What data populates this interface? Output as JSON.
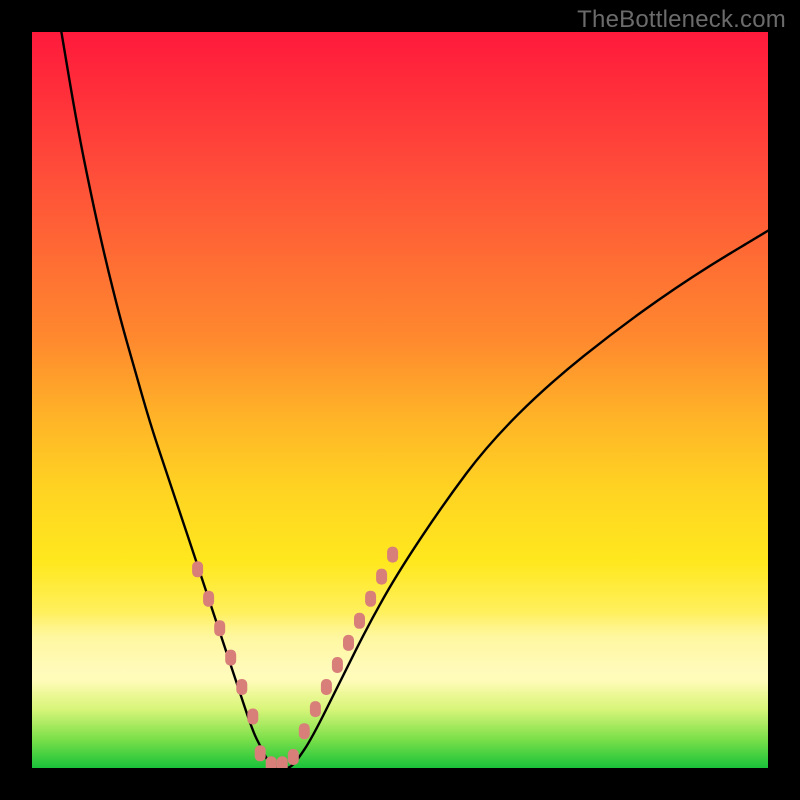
{
  "watermark": "TheBottleneck.com",
  "chart_data": {
    "type": "line",
    "title": "",
    "xlabel": "",
    "ylabel": "",
    "xlim": [
      0,
      100
    ],
    "ylim": [
      0,
      100
    ],
    "grid": false,
    "series": [
      {
        "name": "bottleneck-curve",
        "color": "#000000",
        "x": [
          4,
          6,
          8,
          10,
          12,
          14,
          16,
          18,
          20,
          22,
          24,
          26,
          28,
          30,
          31,
          32,
          33,
          34,
          35,
          36,
          38,
          42,
          46,
          50,
          56,
          62,
          70,
          80,
          90,
          100
        ],
        "values": [
          100,
          88,
          78,
          69,
          61,
          54,
          47,
          41,
          35,
          29,
          23,
          17,
          11,
          5,
          3,
          1,
          0,
          0,
          0,
          1,
          4,
          12,
          20,
          27,
          36,
          44,
          52,
          60,
          67,
          73
        ]
      },
      {
        "name": "marker-dots-left",
        "color": "#d87f7a",
        "x": [
          22.5,
          24.0,
          25.5,
          27.0,
          28.5,
          30.0
        ],
        "values": [
          27.0,
          23.0,
          19.0,
          15.0,
          11.0,
          7.0
        ]
      },
      {
        "name": "marker-dots-bottom",
        "color": "#d87f7a",
        "x": [
          31.0,
          32.5,
          34.0,
          35.5
        ],
        "values": [
          2.0,
          0.5,
          0.5,
          1.5
        ]
      },
      {
        "name": "marker-dots-right",
        "color": "#d87f7a",
        "x": [
          37.0,
          38.5,
          40.0,
          41.5,
          43.0,
          44.5,
          46.0,
          47.5,
          49.0
        ],
        "values": [
          5.0,
          8.0,
          11.0,
          14.0,
          17.0,
          20.0,
          23.0,
          26.0,
          29.0
        ]
      }
    ],
    "background_gradient": {
      "orientation": "vertical",
      "stops": [
        {
          "pos": 0.0,
          "color": "#ff1a3c"
        },
        {
          "pos": 0.3,
          "color": "#ff6a34"
        },
        {
          "pos": 0.62,
          "color": "#ffd322"
        },
        {
          "pos": 0.88,
          "color": "#fffbb0"
        },
        {
          "pos": 1.0,
          "color": "#19c23a"
        }
      ]
    }
  }
}
